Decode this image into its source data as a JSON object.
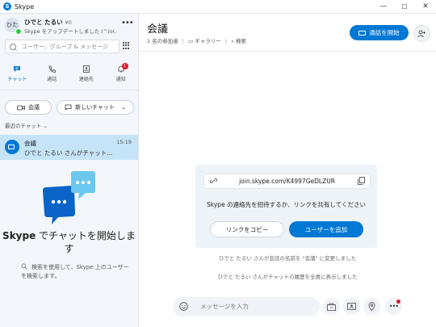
{
  "window": {
    "title": "Skype",
    "controls": {
      "minimize": "—",
      "maximize": "☐",
      "close": "✕"
    }
  },
  "sidebar": {
    "profile": {
      "initials": "ひた",
      "name": "ひでと たるい",
      "balance": "¥0",
      "status_message": "Skype をアップデートしました (^)o(…"
    },
    "search": {
      "placeholder": "ユーザー、グループ & メッセージ"
    },
    "nav_tabs": [
      {
        "label": "チャット",
        "icon": "chat-icon",
        "active": true
      },
      {
        "label": "通話",
        "icon": "phone-icon"
      },
      {
        "label": "連絡先",
        "icon": "contacts-icon"
      },
      {
        "label": "通知",
        "icon": "bell-icon",
        "badge": "1"
      }
    ],
    "meet_now_label": "会議",
    "new_chat_label": "新しいチャット",
    "recent_chats_label": "最近のチャット",
    "chats": [
      {
        "name": "会議",
        "time": "15:19",
        "preview": "ひでと たるい さんがチャット..."
      }
    ],
    "promo": {
      "title_brand": "Skype",
      "title_rest": " でチャットを開始します",
      "description": "検索を使用して、Skype 上のユーザーを検索します。"
    }
  },
  "conversation": {
    "title": "会議",
    "participants": "1 名の参加者",
    "gallery_label": "ギャラリー",
    "search_label": "検索",
    "start_call_label": "通話を開始",
    "invite": {
      "link": "join.skype.com/K4997GeDLZUR",
      "message": "Skype の連絡先を招待するか、リンクを共有してください",
      "copy_label": "リンクをコピー",
      "add_user_label": "ユーザーを追加"
    },
    "system_messages": [
      "ひでと たるい さんが会話の名前を \"会議\" に変更しました",
      "ひでと たるい さんがチャットの履歴を全員に表示しました"
    ],
    "composer": {
      "placeholder": "メッセージを入力"
    }
  },
  "colors": {
    "accent": "#0078d4",
    "selected_chat": "#c6e4f7",
    "badge": "#e81123"
  }
}
